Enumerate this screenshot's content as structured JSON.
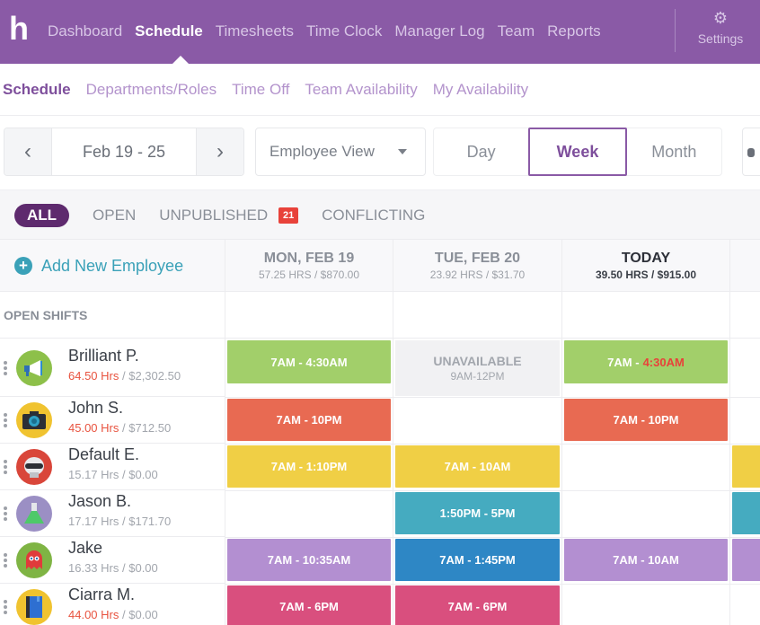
{
  "app": {
    "logo": "h",
    "nav": [
      {
        "label": "Dashboard",
        "active": false
      },
      {
        "label": "Schedule",
        "active": true
      },
      {
        "label": "Timesheets",
        "active": false
      },
      {
        "label": "Time Clock",
        "active": false
      },
      {
        "label": "Manager Log",
        "active": false
      },
      {
        "label": "Team",
        "active": false
      },
      {
        "label": "Reports",
        "active": false
      }
    ],
    "settings_label": "Settings",
    "colors": {
      "brand": "#8a5aa6",
      "accent_active": "#5e2a6e",
      "add_link": "#3aa1b8",
      "overtime": "#e8533f"
    }
  },
  "subnav": [
    {
      "label": "Schedule",
      "active": true
    },
    {
      "label": "Departments/Roles",
      "active": false
    },
    {
      "label": "Time Off",
      "active": false
    },
    {
      "label": "Team Availability",
      "active": false
    },
    {
      "label": "My Availability",
      "active": false
    }
  ],
  "toolbar": {
    "prev_icon": "‹",
    "next_icon": "›",
    "date_range": "Feb 19 - 25",
    "view_select": "Employee View",
    "ranges": [
      {
        "label": "Day",
        "active": false
      },
      {
        "label": "Week",
        "active": true
      },
      {
        "label": "Month",
        "active": false
      }
    ]
  },
  "filters": [
    {
      "label": "ALL",
      "active": true
    },
    {
      "label": "OPEN",
      "active": false
    },
    {
      "label": "UNPUBLISHED",
      "active": false,
      "badge": "21"
    },
    {
      "label": "CONFLICTING",
      "active": false
    }
  ],
  "grid": {
    "add_employee": "Add New Employee",
    "open_shifts_label": "OPEN SHIFTS",
    "days": [
      {
        "title": "MON, FEB 19",
        "summary": "57.25 HRS / $870.00",
        "today": false
      },
      {
        "title": "TUE, FEB 20",
        "summary": "23.92 HRS / $31.70",
        "today": false
      },
      {
        "title": "TODAY",
        "summary": "39.50 HRS / $915.00",
        "today": true
      }
    ],
    "employees": [
      {
        "name": "Brilliant P.",
        "hours": "64.50 Hrs",
        "pay": "$2,302.50",
        "overtime": true,
        "avatar": "megaphone-icon",
        "avatar_color": "#8dc04a",
        "shifts": [
          {
            "type": "shift",
            "label": "7AM - 4:30AM",
            "color": "#a2cf6a"
          },
          {
            "type": "unavailable",
            "label": "UNAVAILABLE",
            "sub": "9AM-12PM"
          },
          {
            "type": "shift",
            "label": "7AM - ",
            "warn": "4:30AM",
            "color": "#a2cf6a"
          }
        ]
      },
      {
        "name": "John S.",
        "hours": "45.00 Hrs",
        "pay": "$712.50",
        "overtime": true,
        "avatar": "camera-icon",
        "avatar_color": "#f0c330",
        "shifts": [
          {
            "type": "shift",
            "label": "7AM - 10PM",
            "color": "#e86a52"
          },
          null,
          {
            "type": "shift",
            "label": "7AM - 10PM",
            "color": "#e86a52"
          }
        ]
      },
      {
        "name": "Default E.",
        "hours": "15.17 Hrs",
        "pay": "$0.00",
        "overtime": false,
        "avatar": "robot-icon",
        "avatar_color": "#d9463a",
        "shifts": [
          {
            "type": "shift",
            "label": "7AM - 1:10PM",
            "color": "#f0cf45"
          },
          {
            "type": "shift",
            "label": "7AM - 10AM",
            "color": "#f0cf45"
          },
          null
        ]
      },
      {
        "name": "Jason B.",
        "hours": "17.17 Hrs",
        "pay": "$171.70",
        "overtime": false,
        "avatar": "flask-icon",
        "avatar_color": "#9b8fc4",
        "shifts": [
          null,
          {
            "type": "shift",
            "label": "1:50PM - 5PM",
            "color": "#45abc0"
          },
          null
        ]
      },
      {
        "name": "Jake",
        "hours": "16.33 Hrs",
        "pay": "$0.00",
        "overtime": false,
        "avatar": "ghost-icon",
        "avatar_color": "#7fb444",
        "shifts": [
          {
            "type": "shift",
            "label": "7AM - 10:35AM",
            "color": "#b38fd1"
          },
          {
            "type": "shift",
            "label": "7AM - 1:45PM",
            "color": "#2e87c5"
          },
          {
            "type": "shift",
            "label": "7AM - 10AM",
            "color": "#b38fd1"
          }
        ]
      },
      {
        "name": "Ciarra M.",
        "hours": "44.00 Hrs",
        "pay": "$0.00",
        "overtime": true,
        "avatar": "book-icon",
        "avatar_color": "#f0c330",
        "shifts": [
          {
            "type": "shift",
            "label": "7AM - 6PM",
            "color": "#d94f7e"
          },
          {
            "type": "shift",
            "label": "7AM - 6PM",
            "color": "#d94f7e"
          },
          null
        ]
      }
    ],
    "partial_next_day_colors": [
      null,
      null,
      "#f0cf45",
      "#45abc0",
      "#b38fd1",
      null
    ]
  }
}
